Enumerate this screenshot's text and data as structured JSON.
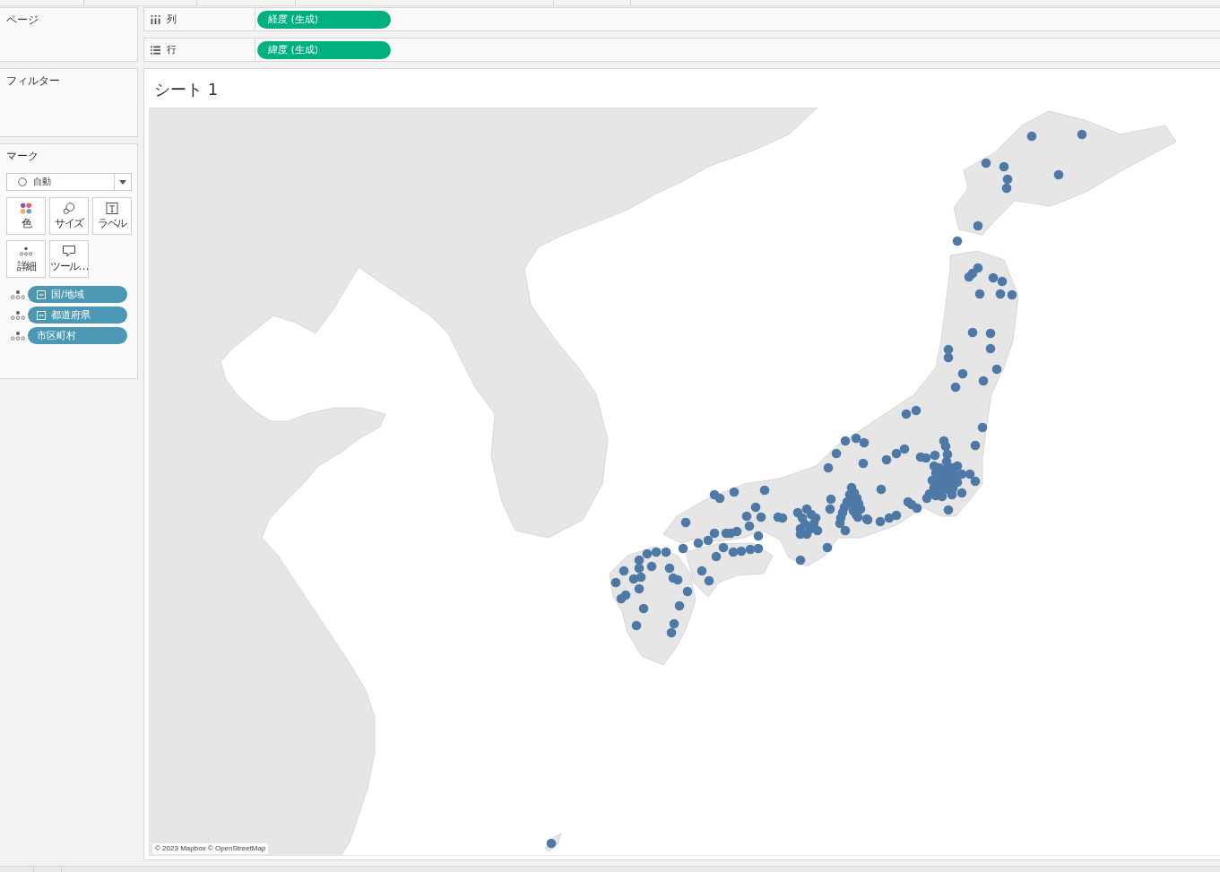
{
  "panels": {
    "pages": {
      "title": "ページ"
    },
    "filters": {
      "title": "フィルター"
    },
    "marks": {
      "title": "マーク",
      "mark_type": {
        "label": "自動"
      },
      "cards": [
        {
          "label": "色",
          "kind": "color"
        },
        {
          "label": "サイズ",
          "kind": "size"
        },
        {
          "label": "ラベル",
          "kind": "label"
        },
        {
          "label": "詳細",
          "kind": "detail"
        },
        {
          "label": "ツール…",
          "kind": "tooltip"
        }
      ],
      "fields": [
        {
          "label": "国/地域",
          "kind": "detail",
          "collapsible": true
        },
        {
          "label": "都道府県",
          "kind": "detail",
          "collapsible": true
        },
        {
          "label": "市区町村",
          "kind": "detail",
          "collapsible": false
        }
      ]
    }
  },
  "shelves": [
    {
      "label": "列",
      "kind": "columns",
      "pills": [
        "経度 (生成)"
      ]
    },
    {
      "label": "行",
      "kind": "rows",
      "pills": [
        "緯度 (生成)"
      ]
    }
  ],
  "sheet": {
    "title": "シート 1",
    "map": {
      "attribution": "© 2023 Mapbox © OpenStreetMap"
    }
  }
}
